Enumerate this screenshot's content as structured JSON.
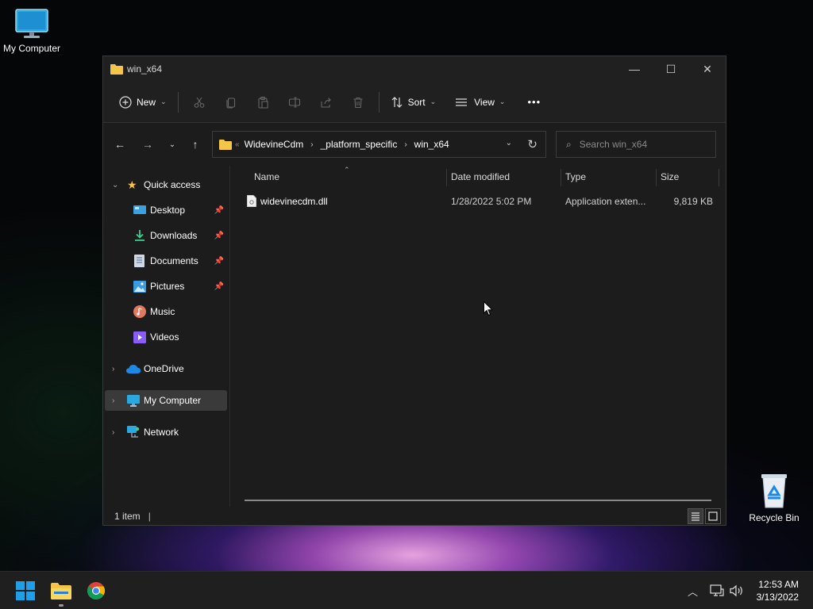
{
  "desktop": {
    "icons": [
      {
        "label": "My Computer",
        "icon": "monitor-icon"
      },
      {
        "label": "Recycle Bin",
        "icon": "recycle-bin-icon"
      }
    ]
  },
  "window": {
    "title": "win_x64",
    "controls": {
      "minimize": "—",
      "maximize": "☐",
      "close": "✕"
    }
  },
  "commandbar": {
    "new_label": "New",
    "sort_label": "Sort",
    "view_label": "View",
    "more_label": "•••"
  },
  "address": {
    "overflow": "«",
    "crumbs": [
      "WidevineCdm",
      "_platform_specific",
      "win_x64"
    ]
  },
  "search": {
    "placeholder": "Search win_x64"
  },
  "sidebar": {
    "quick_access": "Quick access",
    "items": [
      {
        "label": "Desktop",
        "pinned": true
      },
      {
        "label": "Downloads",
        "pinned": true
      },
      {
        "label": "Documents",
        "pinned": true
      },
      {
        "label": "Pictures",
        "pinned": true
      },
      {
        "label": "Music",
        "pinned": false
      },
      {
        "label": "Videos",
        "pinned": false
      }
    ],
    "onedrive": "OneDrive",
    "mycomputer": "My Computer",
    "network": "Network"
  },
  "columns": {
    "name": "Name",
    "date": "Date modified",
    "type": "Type",
    "size": "Size"
  },
  "files": [
    {
      "name": "widevinecdm.dll",
      "date": "1/28/2022 5:02 PM",
      "type": "Application exten...",
      "size": "9,819 KB"
    }
  ],
  "status": {
    "count": "1 item",
    "separator": "|"
  },
  "taskbar": {
    "apps": [
      "windows-start-icon",
      "file-explorer-icon",
      "chrome-icon"
    ],
    "time": "12:53 AM",
    "date": "3/13/2022"
  },
  "colors": {
    "accent": "#0078d4",
    "folder": "#f4c548",
    "window_bg": "#1c1c1c"
  }
}
